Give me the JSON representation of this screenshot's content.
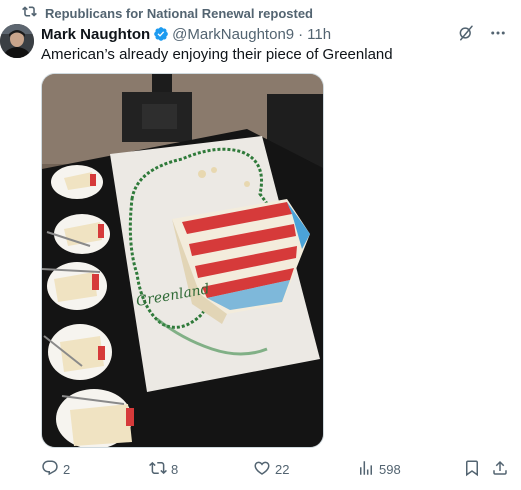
{
  "repost": {
    "icon": "repost-icon",
    "text": "Republicans for National Renewal reposted"
  },
  "author": {
    "name": "Mark Naughton",
    "verified_icon": "verified-badge-icon",
    "handle": "@MarkNaughton9",
    "separator": "·",
    "time": "11h"
  },
  "top_actions": {
    "grok_icon": "grok-icon",
    "more_icon": "more-icon"
  },
  "tweet": {
    "text": "American’s already enjoying their piece of Greenland"
  },
  "media": {
    "cake_label": "Greenland"
  },
  "actions": {
    "reply_count": "2",
    "repost_count": "8",
    "like_count": "22",
    "views_count": "598"
  },
  "colors": {
    "accent": "#1d9bf0",
    "muted": "#536471",
    "text": "#0f1419"
  }
}
